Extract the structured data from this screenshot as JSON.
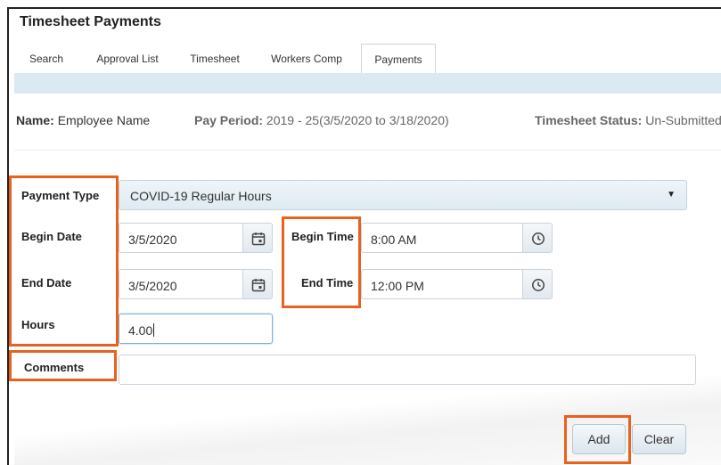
{
  "page": {
    "title": "Timesheet Payments"
  },
  "tabs": [
    {
      "label": "Search"
    },
    {
      "label": "Approval List"
    },
    {
      "label": "Timesheet"
    },
    {
      "label": "Workers Comp"
    },
    {
      "label": "Payments"
    }
  ],
  "info": {
    "name_label": "Name:",
    "name_value": "Employee Name",
    "period_label": "Pay Period:",
    "period_value": "2019 - 25(3/5/2020 to 3/18/2020)",
    "status_label": "Timesheet Status:",
    "status_value": "Un-Submitted"
  },
  "form": {
    "payment_type": {
      "label": "Payment Type",
      "value": "COVID-19 Regular Hours"
    },
    "begin_date": {
      "label": "Begin Date",
      "value": "3/5/2020"
    },
    "end_date": {
      "label": "End Date",
      "value": "3/5/2020"
    },
    "begin_time": {
      "label": "Begin Time",
      "value": "8:00 AM"
    },
    "end_time": {
      "label": "End Time",
      "value": "12:00 PM"
    },
    "hours": {
      "label": "Hours",
      "value": "4.00"
    },
    "comments": {
      "label": "Comments",
      "value": ""
    }
  },
  "buttons": {
    "add": "Add",
    "clear": "Clear"
  },
  "colors": {
    "highlight": "#e8621d",
    "tab_bar": "#dbe9f3"
  },
  "icons": {
    "calendar": "calendar-icon",
    "clock": "clock-icon",
    "caret": "caret-down-icon"
  }
}
